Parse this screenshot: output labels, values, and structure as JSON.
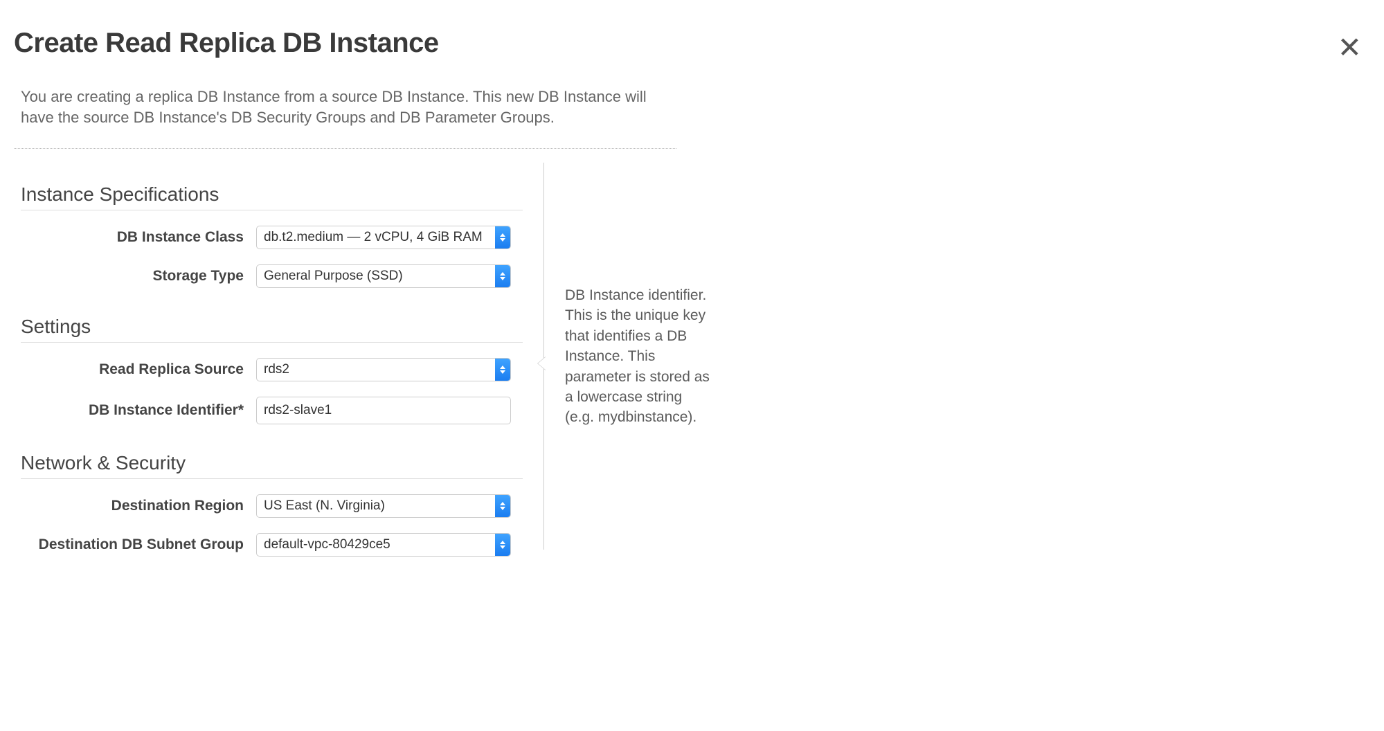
{
  "header": {
    "title": "Create Read Replica DB Instance",
    "intro": "You are creating a replica DB Instance from a source DB Instance. This new DB Instance will have the source DB Instance's DB Security Groups and DB Parameter Groups."
  },
  "sections": {
    "instance_spec": {
      "title": "Instance Specifications",
      "db_instance_class": {
        "label": "DB Instance Class",
        "value": "db.t2.medium — 2 vCPU, 4 GiB RAM"
      },
      "storage_type": {
        "label": "Storage Type",
        "value": "General Purpose (SSD)"
      }
    },
    "settings": {
      "title": "Settings",
      "read_replica_source": {
        "label": "Read Replica Source",
        "value": "rds2"
      },
      "db_instance_identifier": {
        "label": "DB Instance Identifier*",
        "value": "rds2-slave1"
      }
    },
    "network_security": {
      "title": "Network & Security",
      "destination_region": {
        "label": "Destination Region",
        "value": "US East (N. Virginia)"
      },
      "destination_db_subnet_group": {
        "label": "Destination DB Subnet Group",
        "value": "default-vpc-80429ce5"
      }
    }
  },
  "help": {
    "db_instance_identifier": "DB Instance identifier. This is the unique key that identifies a DB Instance. This parameter is stored as a lowercase string (e.g. mydbinstance)."
  }
}
